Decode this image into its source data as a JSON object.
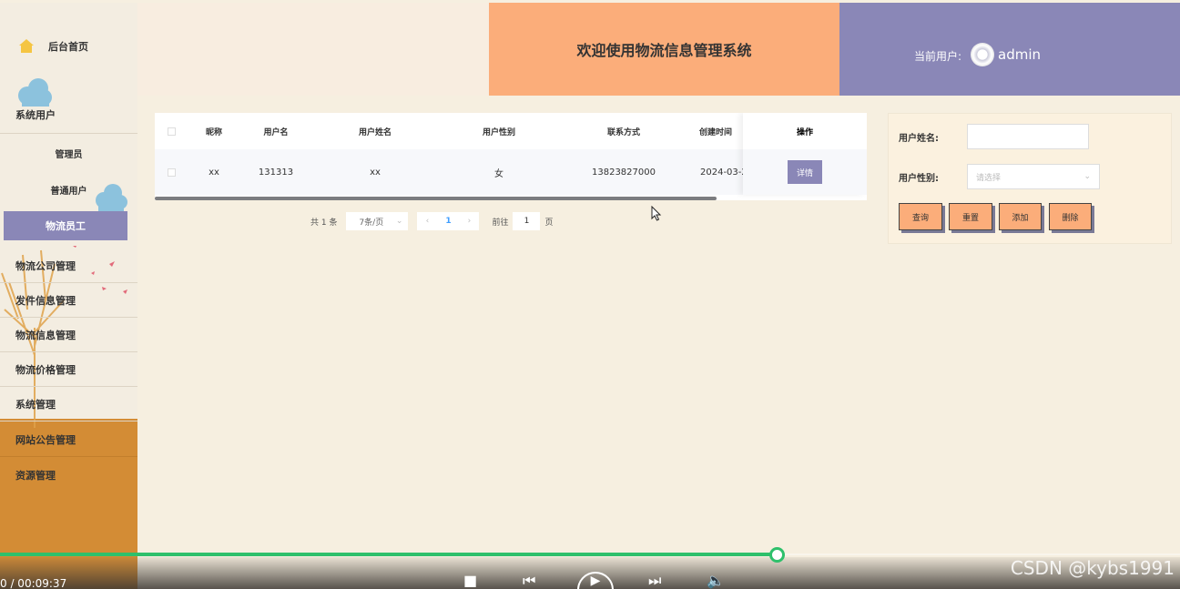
{
  "header": {
    "title": "欢迎使用物流信息管理系统",
    "current_user_label": "当前用户:",
    "username": "admin",
    "home_label": "后台首页"
  },
  "sidebar": {
    "group_system_users": "系统用户",
    "sub_admin": "管理员",
    "sub_normal_user": "普通用户",
    "sub_logistics_staff": "物流员工",
    "items": [
      "物流公司管理",
      "发件信息管理",
      "物流信息管理",
      "物流价格管理",
      "系统管理",
      "网站公告管理",
      "资源管理"
    ]
  },
  "table": {
    "columns": [
      "昵称",
      "用户名",
      "用户姓名",
      "用户性别",
      "联系方式",
      "创建时间",
      "操作"
    ],
    "rows": [
      {
        "nickname": "xx",
        "username": "131313",
        "realname": "xx",
        "gender": "女",
        "phone": "13823827000",
        "created": "2024-03-2",
        "action": "详情"
      }
    ]
  },
  "pagination": {
    "total": "共 1 条",
    "page_size": "7条/页",
    "current_page": "1",
    "goto_label": "前往",
    "goto_value": "1",
    "page_unit": "页"
  },
  "search": {
    "name_label": "用户姓名:",
    "gender_label": "用户性别:",
    "gender_placeholder": "请选择",
    "btn_query": "查询",
    "btn_reset": "重置",
    "btn_add": "添加",
    "btn_delete": "删除"
  },
  "video": {
    "time": "0 / 00:09:37",
    "watermark": "CSDN @kybs1991",
    "progress": 0.66
  },
  "colors": {
    "accent_purple": "#8a87b7",
    "accent_orange": "#fbad7a",
    "sidebar_orange": "#d38c35",
    "progress_green": "#2ec06b"
  }
}
